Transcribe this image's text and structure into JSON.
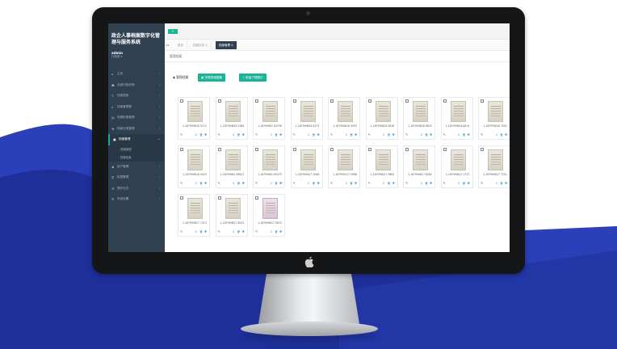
{
  "app": {
    "title": "政企人事档案数字化管理与服务系统",
    "user": "admin",
    "role": "行政部 ▾"
  },
  "sidebar": {
    "items": [
      {
        "label": "主页",
        "icon": "home-icon",
        "glyph": "⌂"
      },
      {
        "label": "全部归档纪律",
        "icon": "users-icon",
        "glyph": "☗"
      },
      {
        "label": "档案搜索",
        "icon": "wrench-icon",
        "glyph": "✎"
      },
      {
        "label": "档案管理管",
        "icon": "bank-icon",
        "glyph": "⌂"
      },
      {
        "label": "档案柜借管理",
        "icon": "file-icon",
        "glyph": "▤"
      },
      {
        "label": "档案分类管理",
        "icon": "tags-icon",
        "glyph": "❖"
      },
      {
        "label": "档案管理",
        "icon": "archive-icon",
        "glyph": "▣",
        "active": true
      },
      {
        "label": "用户管理",
        "icon": "user-icon",
        "glyph": "♟"
      },
      {
        "label": "权限管理",
        "icon": "lock-icon",
        "glyph": "⚿"
      },
      {
        "label": "操作日志",
        "icon": "log-icon",
        "glyph": "☰"
      },
      {
        "label": "系统设置",
        "icon": "gear-icon",
        "glyph": "⚙"
      }
    ],
    "subitems": [
      "档案管理",
      "档案检索"
    ]
  },
  "topbar": {
    "toggle": "☰"
  },
  "tabs": {
    "nav": "◂◂",
    "items": [
      {
        "label": "首页"
      },
      {
        "label": "档案目录 ⊙"
      },
      {
        "label": "档案管理 ⊙",
        "active": true
      }
    ]
  },
  "breadcrumb": "管理档案",
  "toolbar": {
    "label": "◆ 管理档案",
    "btn_add": "▣ 关联档案图集",
    "btn_download": "⇩ 批量下载图片"
  },
  "cards": [
    {
      "name": "1-167990816 5712",
      "color": "paper"
    },
    {
      "name": "1-167990816 2385",
      "color": "paper"
    },
    {
      "name": "1-16799081 63706",
      "color": "paper"
    },
    {
      "name": "1-167990816 4373",
      "color": "paper"
    },
    {
      "name": "1-167990816 4593",
      "color": "paper"
    },
    {
      "name": "1-167990816 5618",
      "color": "paper"
    },
    {
      "name": "1-167990816 6625",
      "color": "paper"
    },
    {
      "name": "1-167990816 8474",
      "color": "paper"
    },
    {
      "name": "1-167990816 7002",
      "color": "paper"
    },
    {
      "name": "1-167990816 9023",
      "color": "paper"
    },
    {
      "name": "1-16799081 69501",
      "color": "paper"
    },
    {
      "name": "1-16799081 69375",
      "color": "paper"
    },
    {
      "name": "1-167990017 0948",
      "color": "paper"
    },
    {
      "name": "1-167990017 0568",
      "color": "paper"
    },
    {
      "name": "1-167990017 5681",
      "color": "paper"
    },
    {
      "name": "1-167990817 6282",
      "color": "paper"
    },
    {
      "name": "1-167990817 0737",
      "color": "paper"
    },
    {
      "name": "1-167990817 7201",
      "color": "paper"
    },
    {
      "name": "1-167990817 7413",
      "color": "paper"
    },
    {
      "name": "1-167990817 8232",
      "color": "paper"
    },
    {
      "name": "1-167990817 9023",
      "color": "pink"
    }
  ],
  "actions": {
    "edit": "✎",
    "download": "⇩",
    "delete": "🗑",
    "move": "✥"
  },
  "colors": {
    "accent": "#1ab394",
    "sidebar": "#2f4050",
    "link": "#1c84c6"
  }
}
